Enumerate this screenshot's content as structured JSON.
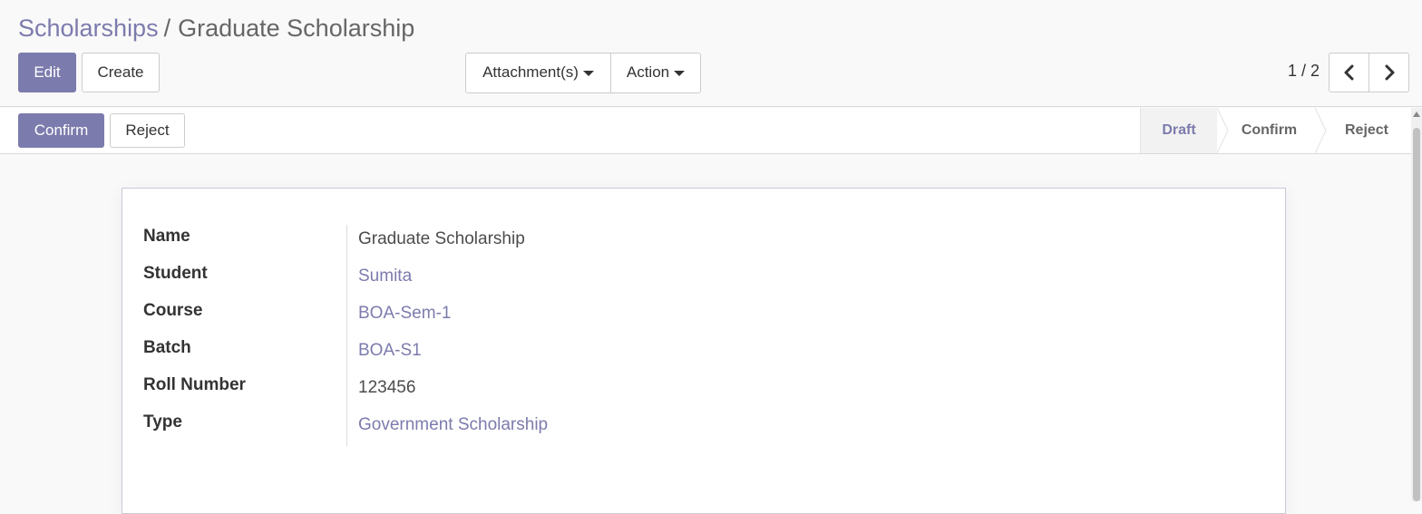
{
  "breadcrumb": {
    "parent": "Scholarships",
    "separator": "/",
    "current": "Graduate Scholarship"
  },
  "toolbar": {
    "edit_label": "Edit",
    "create_label": "Create",
    "attachments_label": "Attachment(s)",
    "action_label": "Action"
  },
  "pager": {
    "value": "1 / 2",
    "prev_icon": "chevron-left-icon",
    "next_icon": "chevron-right-icon"
  },
  "header_buttons": {
    "confirm_label": "Confirm",
    "reject_label": "Reject"
  },
  "statusbar": {
    "stages": [
      {
        "label": "Draft",
        "active": true
      },
      {
        "label": "Confirm",
        "active": false
      },
      {
        "label": "Reject",
        "active": false
      }
    ]
  },
  "form": {
    "fields": [
      {
        "label": "Name",
        "value": "Graduate Scholarship",
        "is_link": false
      },
      {
        "label": "Student",
        "value": "Sumita",
        "is_link": true
      },
      {
        "label": "Course",
        "value": "BOA-Sem-1",
        "is_link": true
      },
      {
        "label": "Batch",
        "value": "BOA-S1",
        "is_link": true
      },
      {
        "label": "Roll Number",
        "value": "123456",
        "is_link": false
      },
      {
        "label": "Type",
        "value": "Government Scholarship",
        "is_link": true
      }
    ]
  },
  "colors": {
    "accent": "#7c7bad",
    "text": "#4c4c4c",
    "background": "#f9f9f9"
  }
}
